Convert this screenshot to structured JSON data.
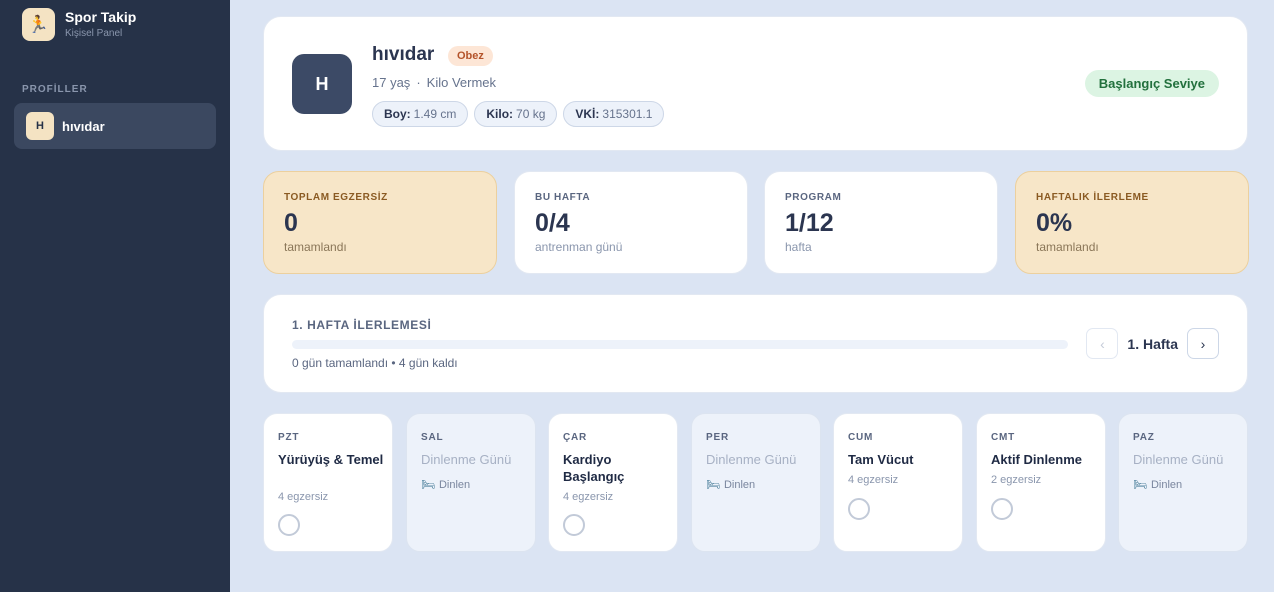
{
  "sidebar": {
    "brand_title": "Spor Takip",
    "brand_subtitle": "Kişisel Panel",
    "brand_icon": "runner-icon",
    "section_label": "PROFİLLER",
    "profiles": [
      {
        "initial": "H",
        "name": "hıvıdar"
      }
    ]
  },
  "profile": {
    "initial": "H",
    "name": "hıvıdar",
    "badge": "Obez",
    "age": "17 yaş",
    "separator": "·",
    "goal": "Kilo Vermek",
    "chips": [
      {
        "key": "Boy:",
        "value": "1.49 cm"
      },
      {
        "key": "Kilo:",
        "value": "70 kg"
      },
      {
        "key": "VKİ:",
        "value": "315301.1"
      }
    ],
    "level": "Başlangıç Seviye"
  },
  "stats": [
    {
      "label": "TOPLAM EGZERSİZ",
      "value": "0",
      "sub": "tamamlandı"
    },
    {
      "label": "BU HAFTA",
      "value": "0/4",
      "sub": "antrenman günü"
    },
    {
      "label": "PROGRAM",
      "value": "1/12",
      "sub": "hafta"
    },
    {
      "label": "HAFTALIK İLERLEME",
      "value": "0%",
      "sub": "tamamlandı"
    }
  ],
  "progress": {
    "title": "1. HAFTA İLERLEMESİ",
    "fraction": 0,
    "summary": "0 gün tamamlandı • 4 gün kaldı",
    "prev_symbol": "‹",
    "week_label": "1. Hafta",
    "next_symbol": "›"
  },
  "days": [
    {
      "code": "PZT",
      "name": "Yürüyüş & Temel",
      "sub": "4 egzersiz",
      "rest": false
    },
    {
      "code": "SAL",
      "name": "Dinlenme Günü",
      "sub": "Dinlen",
      "rest": true
    },
    {
      "code": "ÇAR",
      "name": "Kardiyo Başlangıç",
      "sub": "4 egzersiz",
      "rest": false
    },
    {
      "code": "PER",
      "name": "Dinlenme Günü",
      "sub": "Dinlen",
      "rest": true
    },
    {
      "code": "CUM",
      "name": "Tam Vücut",
      "sub": "4 egzersiz",
      "rest": false
    },
    {
      "code": "CMT",
      "name": "Aktif Dinlenme",
      "sub": "2 egzersiz",
      "rest": false
    },
    {
      "code": "PAZ",
      "name": "Dinlenme Günü",
      "sub": "Dinlen",
      "rest": true
    }
  ]
}
